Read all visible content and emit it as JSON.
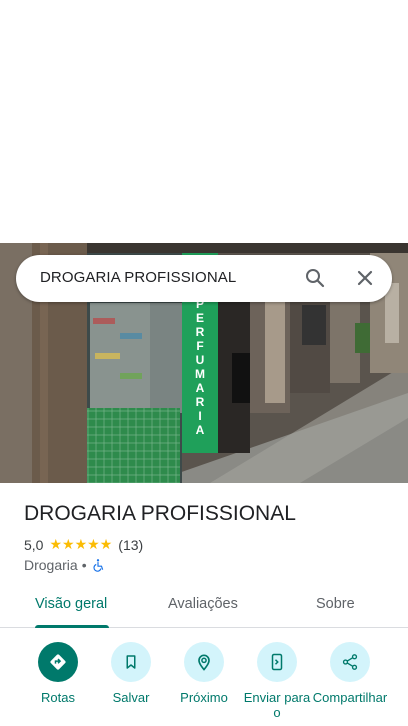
{
  "search": {
    "query": "DROGARIA PROFISSIONAL"
  },
  "photo": {
    "sign_text": "PERFUMARIA"
  },
  "place": {
    "title": "DROGARIA PROFISSIONAL",
    "rating": "5,0",
    "stars": [
      "★",
      "★",
      "★",
      "★",
      "★"
    ],
    "review_count": "(13)",
    "category": "Drogaria",
    "separator": "•"
  },
  "tabs": [
    {
      "label": "Visão geral",
      "active": true
    },
    {
      "label": "Avaliações",
      "active": false
    },
    {
      "label": "Sobre",
      "active": false
    }
  ],
  "actions": [
    {
      "label": "Rotas",
      "icon": "directions-icon"
    },
    {
      "label": "Salvar",
      "icon": "bookmark-icon"
    },
    {
      "label": "Próximo",
      "icon": "nearby-icon"
    },
    {
      "label": "Enviar para o",
      "icon": "send-to-phone-icon"
    },
    {
      "label": "Compartilhar",
      "icon": "share-icon"
    }
  ],
  "colors": {
    "accent": "#00796b",
    "action_bg": "#d3f4fb",
    "star": "#fbbc04",
    "sign_green": "#1fa05a"
  }
}
